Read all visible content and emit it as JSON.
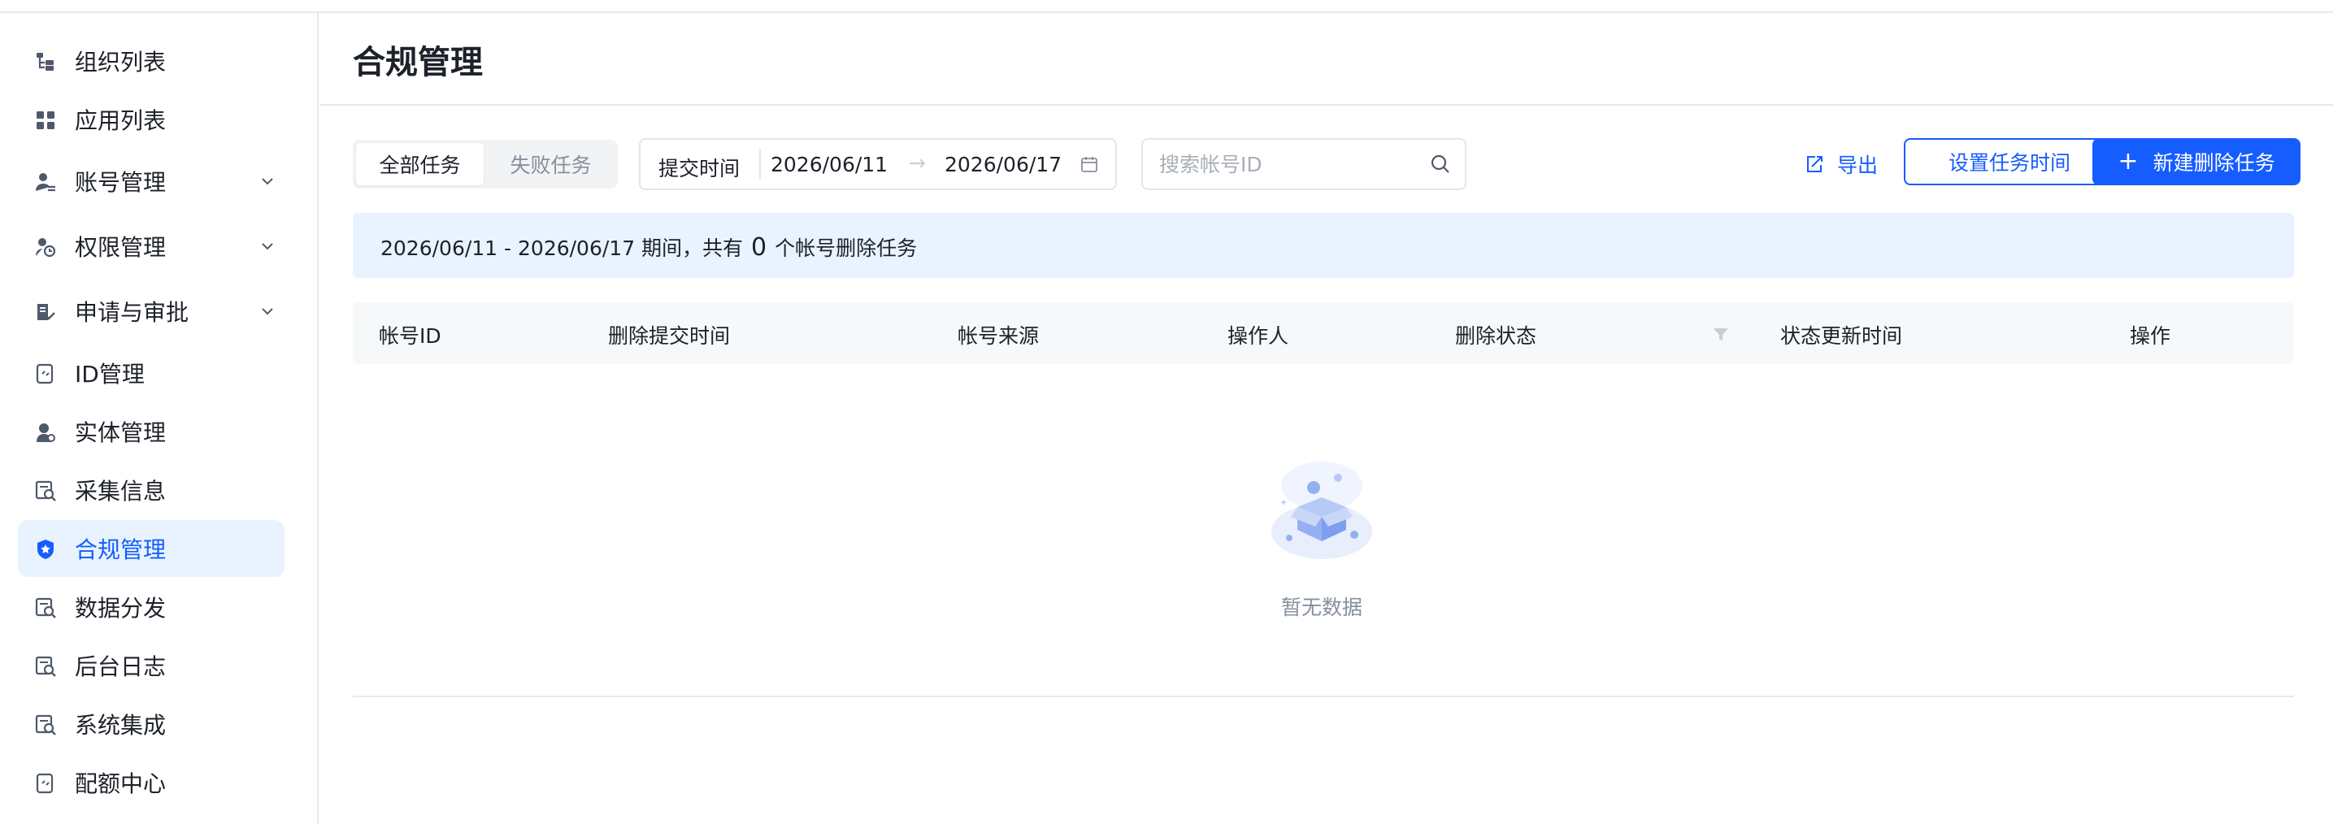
{
  "colors": {
    "accent": "#165dff",
    "active_bg": "#e8f3ff",
    "banner_bg": "#e8f3ff",
    "text": "#1d2129",
    "muted": "#86909c"
  },
  "sidebar": {
    "items": [
      {
        "label": "组织列表",
        "icon": "org-tree-icon"
      },
      {
        "label": "应用列表",
        "icon": "app-grid-icon"
      },
      {
        "label": "账号管理",
        "icon": "user-manage-icon",
        "expandable": true
      },
      {
        "label": "权限管理",
        "icon": "permission-icon",
        "expandable": true
      },
      {
        "label": "申请与审批",
        "icon": "approval-icon",
        "expandable": true
      },
      {
        "label": "ID管理",
        "icon": "id-manage-icon"
      },
      {
        "label": "实体管理",
        "icon": "entity-icon"
      },
      {
        "label": "采集信息",
        "icon": "collect-icon"
      },
      {
        "label": "合规管理",
        "icon": "shield-icon",
        "active": true
      },
      {
        "label": "数据分发",
        "icon": "distribute-icon"
      },
      {
        "label": "后台日志",
        "icon": "log-icon"
      },
      {
        "label": "系统集成",
        "icon": "integration-icon"
      },
      {
        "label": "配额中心",
        "icon": "quota-icon"
      }
    ]
  },
  "page": {
    "title": "合规管理"
  },
  "toolbar": {
    "tabs": [
      {
        "label": "全部任务",
        "selected": true
      },
      {
        "label": "失败任务",
        "selected": false
      }
    ],
    "date_range": {
      "label": "提交时间",
      "start": "2026/06/11",
      "arrow": "→",
      "end": "2026/06/17"
    },
    "search": {
      "placeholder": "搜索帐号ID",
      "value": ""
    },
    "export_label": "导出",
    "set_time_label": "设置任务时间",
    "new_task_label": "新建删除任务",
    "new_task_plus": "+"
  },
  "banner": {
    "prefix": "2026/06/11 - 2026/06/17 期间，共有",
    "count": "0",
    "suffix": "个帐号删除任务"
  },
  "table": {
    "columns": [
      "帐号ID",
      "删除提交时间",
      "帐号来源",
      "操作人",
      "删除状态",
      "状态更新时间",
      "操作"
    ],
    "rows": [],
    "empty_text": "暂无数据"
  }
}
